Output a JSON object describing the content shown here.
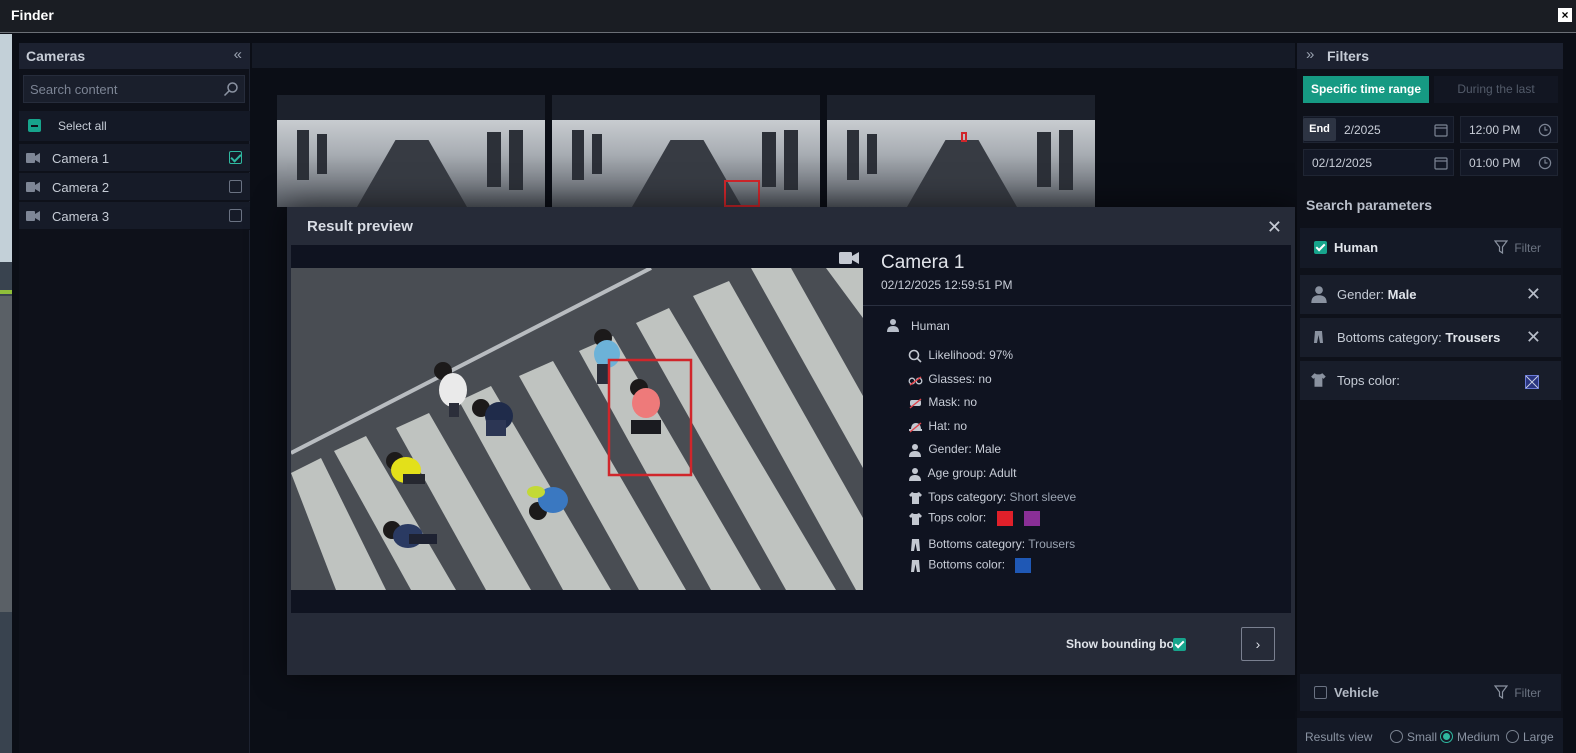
{
  "window": {
    "title": "Finder",
    "close_glyph": "×"
  },
  "cameras": {
    "title": "Cameras",
    "collapse_glyph": "«",
    "search_placeholder": "Search content",
    "select_all": "Select all",
    "items": [
      {
        "label": "Camera 1",
        "checked": true
      },
      {
        "label": "Camera 2",
        "checked": false
      },
      {
        "label": "Camera 3",
        "checked": false
      }
    ]
  },
  "modal": {
    "title": "Result preview",
    "close_glyph": "✕",
    "camera": "Camera 1",
    "datetime": "02/12/2025 12:59:51 PM",
    "object_type": "Human",
    "attributes": [
      {
        "label": "Likelihood:",
        "value": "97%",
        "icon": "magnifier-icon"
      },
      {
        "label": "Glasses:",
        "value": "no",
        "icon": "glasses-icon"
      },
      {
        "label": "Mask:",
        "value": "no",
        "icon": "mask-icon"
      },
      {
        "label": "Hat:",
        "value": "no",
        "icon": "hat-icon"
      },
      {
        "label": "Gender:",
        "value": "Male",
        "icon": "person-icon"
      },
      {
        "label": "Age group:",
        "value": "Adult",
        "icon": "person-icon"
      },
      {
        "label": "Tops category:",
        "value": "Short sleeve",
        "icon": "shirt-icon"
      },
      {
        "label": "Tops color:",
        "value": "",
        "icon": "shirt-icon"
      },
      {
        "label": "Bottoms category:",
        "value": "Trousers",
        "icon": "trousers-icon"
      },
      {
        "label": "Bottoms color:",
        "value": "",
        "icon": "trousers-icon"
      }
    ],
    "tops_colors": [
      "#e0202a",
      "#8a2f97"
    ],
    "bottoms_colors": [
      "#1f58b5"
    ],
    "show_bounding_box": "Show bounding box",
    "next_glyph": "›"
  },
  "filters": {
    "title": "Filters",
    "expand_glyph": "»",
    "time_tabs": {
      "active": "Specific time range",
      "inactive": "During the last"
    },
    "end_tag": "End",
    "start_date": "2/2025",
    "start_time": "12:00 PM",
    "end_date": "02/12/2025",
    "end_time": "01:00 PM",
    "search_params": "Search parameters",
    "human": {
      "label": "Human",
      "filter": "Filter"
    },
    "gender": {
      "label": "Gender:",
      "value": "Male"
    },
    "bottoms": {
      "label": "Bottoms category:",
      "value": "Trousers"
    },
    "tops": {
      "label": "Tops color:"
    },
    "remove_glyph": "✕",
    "vehicle": {
      "label": "Vehicle",
      "filter": "Filter"
    },
    "results_view": {
      "label": "Results view",
      "small": "Small",
      "medium": "Medium",
      "large": "Large"
    }
  },
  "colors": {
    "accent": "#17a48c",
    "bbox": "#d0262b"
  }
}
